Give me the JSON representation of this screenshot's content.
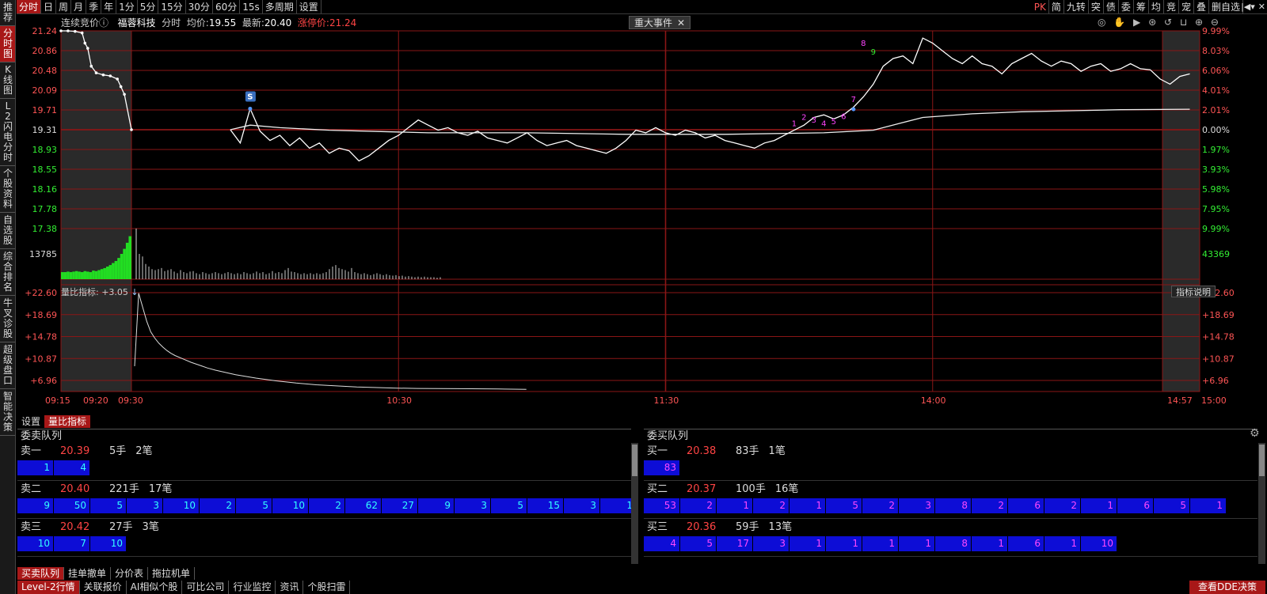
{
  "sidebar": {
    "items": [
      {
        "label": "推荐"
      },
      {
        "label": "分时图"
      },
      {
        "label": "K线图"
      },
      {
        "label": "L2闪电分时"
      },
      {
        "label": "个股资料"
      },
      {
        "label": "自选股"
      },
      {
        "label": "综合排名"
      },
      {
        "label": "牛叉诊股"
      },
      {
        "label": "超级盘口"
      },
      {
        "label": "智能决策"
      }
    ]
  },
  "toolbar": {
    "periods": [
      "分时",
      "日",
      "周",
      "月",
      "季",
      "年",
      "1分",
      "5分",
      "15分",
      "30分",
      "60分",
      "15s",
      "多周期",
      "设置"
    ],
    "right_tools": [
      "PK",
      "简",
      "九转",
      "突",
      "债",
      "委",
      "筹",
      "均",
      "竞",
      "宠",
      "叠",
      "删自选"
    ],
    "nav_icons": [
      "|◀▾",
      "✕"
    ]
  },
  "info": {
    "auction": "连续竞价",
    "name": "福蓉科技",
    "mode": "分时",
    "avg_label": "均价:",
    "avg": "19.55",
    "last_label": "最新:",
    "last": "20.40",
    "limit_label": "涨停价:",
    "limit": "21.24"
  },
  "events": {
    "label": "重大事件",
    "close": "✕"
  },
  "chart_tools": "◎ ✋ ▶ ⊛ ↺ ⊔ ⊕ ⊖",
  "volume_ratio": {
    "label": "量比指标: +3.05",
    "arrow": "↓",
    "help": "指标说明"
  },
  "indicator_tabs": [
    "设置",
    "量比指标"
  ],
  "colors": {
    "up": "#ff4444",
    "down": "#33ee33",
    "grid": "#8a1616",
    "accent": "#a81818",
    "queue_bg": "#0d0dd6"
  },
  "chart_data": {
    "type": "line",
    "price_ticks": [
      "21.24",
      "20.86",
      "20.48",
      "20.09",
      "19.71",
      "19.31",
      "18.93",
      "18.55",
      "18.16",
      "17.78",
      "17.38"
    ],
    "pct_ticks_up": [
      "9.99%",
      "8.03%",
      "6.06%",
      "4.01%",
      "2.01%"
    ],
    "pct_zero": "0.00%",
    "pct_ticks_down": [
      "1.97%",
      "3.93%",
      "5.98%",
      "7.95%",
      "9.99%"
    ],
    "ylim": [
      17.38,
      21.24
    ],
    "prev_close": 19.31,
    "volume_ticks": [
      "13785"
    ],
    "volume_right_tick": "43369",
    "ratio_ticks": [
      "+22.60",
      "+18.69",
      "+14.78",
      "+10.87",
      "+6.96"
    ],
    "ratio_ylim": [
      5.0,
      22.6
    ],
    "x_ticks": [
      "09:15",
      "09:20",
      "09:30",
      "10:30",
      "11:30",
      "14:00",
      "14:57",
      "15:00"
    ],
    "markers": {
      "signal": "S",
      "seq": [
        "1",
        "2",
        "3",
        "4",
        "5",
        "6",
        "7",
        "8",
        "9"
      ]
    },
    "auction_price": [
      [
        0,
        21.24
      ],
      [
        1,
        21.24
      ],
      [
        2,
        21.23
      ],
      [
        3,
        21.2
      ],
      [
        3.4,
        21.0
      ],
      [
        3.8,
        20.9
      ],
      [
        4.3,
        20.55
      ],
      [
        5,
        20.42
      ],
      [
        6,
        20.38
      ],
      [
        7,
        20.36
      ],
      [
        8,
        20.3
      ],
      [
        8.5,
        20.15
      ],
      [
        9,
        20.0
      ],
      [
        10,
        19.31
      ]
    ],
    "price": [
      [
        10,
        19.31
      ],
      [
        11,
        19.05
      ],
      [
        12,
        19.72
      ],
      [
        13,
        19.28
      ],
      [
        14,
        19.1
      ],
      [
        15,
        19.2
      ],
      [
        16,
        19.0
      ],
      [
        17,
        19.15
      ],
      [
        18,
        18.95
      ],
      [
        19,
        19.05
      ],
      [
        20,
        18.85
      ],
      [
        21,
        18.95
      ],
      [
        22,
        18.9
      ],
      [
        23,
        18.7
      ],
      [
        24,
        18.8
      ],
      [
        25,
        18.95
      ],
      [
        26,
        19.1
      ],
      [
        27,
        19.2
      ],
      [
        28,
        19.35
      ],
      [
        29,
        19.5
      ],
      [
        30,
        19.4
      ],
      [
        31,
        19.3
      ],
      [
        32,
        19.35
      ],
      [
        33,
        19.25
      ],
      [
        34,
        19.2
      ],
      [
        35,
        19.28
      ],
      [
        36,
        19.15
      ],
      [
        37,
        19.1
      ],
      [
        38,
        19.05
      ],
      [
        39,
        19.15
      ],
      [
        40,
        19.25
      ],
      [
        41,
        19.1
      ],
      [
        42,
        19.0
      ],
      [
        43,
        19.05
      ],
      [
        44,
        19.1
      ],
      [
        45,
        19.0
      ],
      [
        46,
        18.95
      ],
      [
        47,
        18.9
      ],
      [
        48,
        18.85
      ],
      [
        49,
        18.95
      ],
      [
        50,
        19.1
      ],
      [
        51,
        19.3
      ],
      [
        52,
        19.25
      ],
      [
        53,
        19.35
      ],
      [
        54,
        19.25
      ],
      [
        55,
        19.2
      ],
      [
        56,
        19.3
      ],
      [
        57,
        19.25
      ],
      [
        58,
        19.15
      ],
      [
        59,
        19.2
      ],
      [
        60,
        19.1
      ],
      [
        61,
        19.05
      ],
      [
        62,
        19.0
      ],
      [
        63,
        18.95
      ],
      [
        64,
        19.05
      ],
      [
        65,
        19.1
      ],
      [
        66,
        19.2
      ],
      [
        67,
        19.3
      ],
      [
        68,
        19.4
      ],
      [
        69,
        19.55
      ],
      [
        70,
        19.6
      ],
      [
        71,
        19.52
      ],
      [
        72,
        19.6
      ],
      [
        73,
        19.75
      ],
      [
        74,
        19.95
      ],
      [
        75,
        20.2
      ],
      [
        76,
        20.55
      ],
      [
        77,
        20.7
      ],
      [
        78,
        20.75
      ],
      [
        79,
        20.6
      ],
      [
        80,
        21.1
      ],
      [
        81,
        21.0
      ],
      [
        82,
        20.85
      ],
      [
        83,
        20.7
      ],
      [
        84,
        20.6
      ],
      [
        85,
        20.75
      ],
      [
        86,
        20.6
      ],
      [
        87,
        20.55
      ],
      [
        88,
        20.4
      ],
      [
        89,
        20.6
      ],
      [
        90,
        20.7
      ],
      [
        91,
        20.8
      ],
      [
        92,
        20.65
      ],
      [
        93,
        20.55
      ],
      [
        94,
        20.65
      ],
      [
        95,
        20.6
      ],
      [
        96,
        20.45
      ],
      [
        97,
        20.55
      ],
      [
        98,
        20.6
      ],
      [
        99,
        20.45
      ],
      [
        100,
        20.5
      ],
      [
        101,
        20.6
      ],
      [
        102,
        20.5
      ],
      [
        103,
        20.48
      ],
      [
        104,
        20.3
      ],
      [
        105,
        20.2
      ],
      [
        106,
        20.35
      ],
      [
        107,
        20.4
      ]
    ],
    "avg_price": [
      [
        10,
        19.31
      ],
      [
        12,
        19.4
      ],
      [
        15,
        19.35
      ],
      [
        20,
        19.3
      ],
      [
        30,
        19.25
      ],
      [
        40,
        19.25
      ],
      [
        50,
        19.22
      ],
      [
        60,
        19.22
      ],
      [
        70,
        19.25
      ],
      [
        75,
        19.3
      ],
      [
        78,
        19.45
      ],
      [
        80,
        19.55
      ],
      [
        85,
        19.62
      ],
      [
        90,
        19.66
      ],
      [
        95,
        19.68
      ],
      [
        100,
        19.7
      ],
      [
        107,
        19.71
      ]
    ],
    "auction_volume": [
      0.14,
      0.14,
      0.15,
      0.14,
      0.15,
      0.16,
      0.15,
      0.14,
      0.16,
      0.15,
      0.14,
      0.17,
      0.16,
      0.18,
      0.2,
      0.22,
      0.25,
      0.28,
      0.32,
      0.36,
      0.42,
      0.5,
      0.6,
      0.72,
      0.85
    ],
    "volume": [
      1.0,
      0.5,
      0.45,
      0.3,
      0.25,
      0.2,
      0.18,
      0.2,
      0.22,
      0.16,
      0.18,
      0.2,
      0.15,
      0.12,
      0.18,
      0.14,
      0.12,
      0.15,
      0.16,
      0.12,
      0.1,
      0.14,
      0.12,
      0.1,
      0.12,
      0.14,
      0.12,
      0.1,
      0.12,
      0.14,
      0.12,
      0.1,
      0.12,
      0.1,
      0.14,
      0.12,
      0.1,
      0.12,
      0.15,
      0.12,
      0.14,
      0.1,
      0.12,
      0.16,
      0.12,
      0.14,
      0.12,
      0.18,
      0.22,
      0.15,
      0.14,
      0.12,
      0.1,
      0.12,
      0.1,
      0.12,
      0.1,
      0.12,
      0.1,
      0.12,
      0.14,
      0.2,
      0.25,
      0.28,
      0.22,
      0.2,
      0.18,
      0.15,
      0.22,
      0.14,
      0.12,
      0.1,
      0.12,
      0.1,
      0.08,
      0.1,
      0.12,
      0.1,
      0.08,
      0.1,
      0.08,
      0.07,
      0.08,
      0.06,
      0.07,
      0.05,
      0.06,
      0.05,
      0.04,
      0.05,
      0.04,
      0.05,
      0.04,
      0.04,
      0.04,
      0.03,
      0.04
    ],
    "volume_ratio_series": [
      [
        0,
        9.5
      ],
      [
        1,
        22.5
      ],
      [
        2,
        20
      ],
      [
        3,
        17.5
      ],
      [
        4,
        15.6
      ],
      [
        5,
        14.5
      ],
      [
        6,
        13.6
      ],
      [
        7,
        12.9
      ],
      [
        8,
        12.3
      ],
      [
        9,
        11.8
      ],
      [
        10,
        11.4
      ],
      [
        12,
        10.8
      ],
      [
        14,
        10.2
      ],
      [
        16,
        9.7
      ],
      [
        18,
        9.2
      ],
      [
        20,
        8.8
      ],
      [
        25,
        8.0
      ],
      [
        30,
        7.4
      ],
      [
        35,
        6.9
      ],
      [
        40,
        6.5
      ],
      [
        45,
        6.2
      ],
      [
        50,
        6.0
      ],
      [
        55,
        5.8
      ],
      [
        60,
        5.7
      ],
      [
        65,
        5.6
      ],
      [
        70,
        5.55
      ],
      [
        80,
        5.5
      ],
      [
        90,
        5.45
      ],
      [
        97,
        5.4
      ]
    ]
  },
  "sell_queue": {
    "title": "委卖队列",
    "rows": [
      {
        "name": "卖一",
        "price": "20.39",
        "vol": "5手",
        "count": "2笔",
        "orders": [
          "1",
          "4"
        ]
      },
      {
        "name": "卖二",
        "price": "20.40",
        "vol": "221手",
        "count": "17笔",
        "orders": [
          "9",
          "50",
          "5",
          "3",
          "10",
          "2",
          "5",
          "10",
          "2",
          "62",
          "27",
          "9",
          "3",
          "5",
          "15",
          "3",
          "1"
        ]
      },
      {
        "name": "卖三",
        "price": "20.42",
        "vol": "27手",
        "count": "3笔",
        "orders": [
          "10",
          "7",
          "10"
        ]
      }
    ]
  },
  "buy_queue": {
    "title": "委买队列",
    "rows": [
      {
        "name": "买一",
        "price": "20.38",
        "vol": "83手",
        "count": "1笔",
        "orders": [
          "83"
        ]
      },
      {
        "name": "买二",
        "price": "20.37",
        "vol": "100手",
        "count": "16笔",
        "orders": [
          "53",
          "2",
          "1",
          "2",
          "1",
          "5",
          "2",
          "3",
          "8",
          "2",
          "6",
          "2",
          "1",
          "6",
          "5",
          "1"
        ]
      },
      {
        "name": "买三",
        "price": "20.36",
        "vol": "59手",
        "count": "13笔",
        "orders": [
          "4",
          "5",
          "17",
          "3",
          "1",
          "1",
          "1",
          "1",
          "8",
          "1",
          "6",
          "1",
          "10"
        ]
      }
    ]
  },
  "bottom_tabs": [
    "买卖队列",
    "挂单撤单",
    "分价表",
    "拖拉机单"
  ],
  "status_tabs": [
    "Level-2行情",
    "关联报价",
    "AI相似个股",
    "可比公司",
    "行业监控",
    "资讯",
    "个股扫雷"
  ],
  "dde_button": "查看DDE决策"
}
